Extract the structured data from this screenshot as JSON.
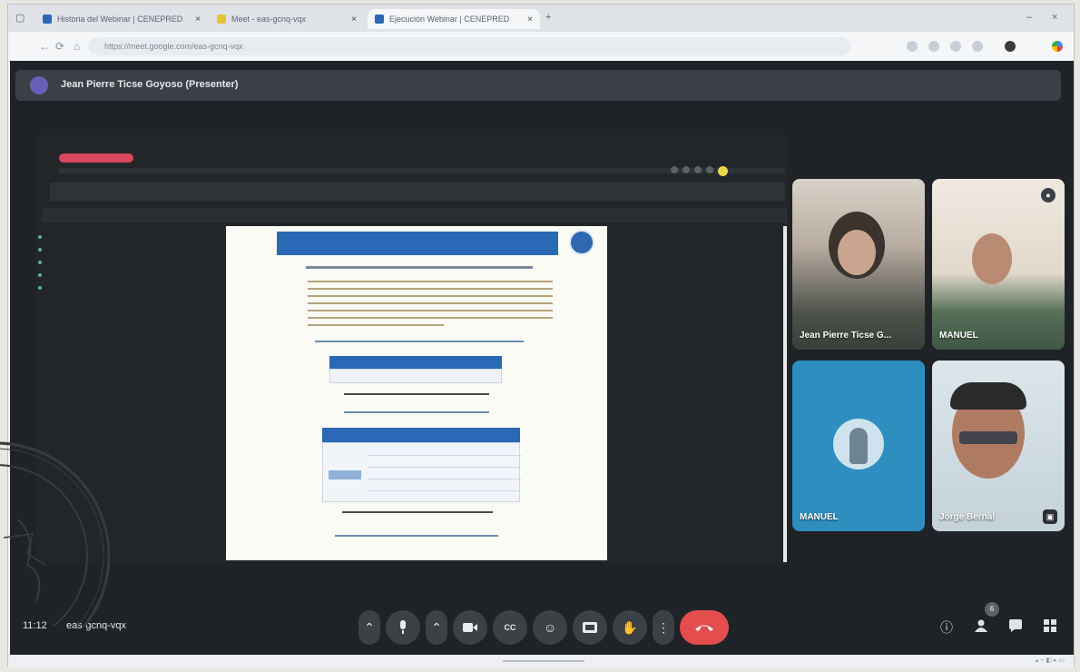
{
  "browser": {
    "tabs": [
      {
        "title": "Historia del Webinar | CENEPRED",
        "active": false,
        "favicon_color": "#2b68b5"
      },
      {
        "title": "Meet - eas-gcnq-vqx",
        "active": false,
        "favicon_color": "#e8c33a"
      },
      {
        "title": "Ejecución Webinar | CENEPRED",
        "active": true,
        "favicon_color": "#2b68b5"
      }
    ],
    "new_tab": "+",
    "url": "https://meet.google.com/eas-gcnq-vqx"
  },
  "meet": {
    "presenter_label": "Jean Pierre Ticse Goyoso (Presenter)",
    "participants": [
      {
        "name": "Jean Pierre Ticse G...",
        "camera": "on"
      },
      {
        "name": "MANUEL",
        "camera": "on"
      },
      {
        "name": "MANUEL",
        "camera": "off"
      },
      {
        "name": "Jorge Bernal",
        "camera": "on"
      }
    ],
    "meeting_code": "eas-gcnq-vqx",
    "time": "11:12",
    "participant_count": "6",
    "controls": {
      "more_audio": "⌃",
      "mic": "mic",
      "more_video": "⌃",
      "camera": "camera",
      "captions": "CC",
      "reactions": "☺",
      "present": "present",
      "raise_hand": "✋",
      "more": "⋮",
      "leave": "leave call"
    }
  },
  "colors": {
    "meet_bg": "#1f2327",
    "leave_red": "#e34d4d",
    "doc_header_blue": "#2b68b5"
  },
  "icons": {
    "info": "info-icon",
    "people": "people-icon",
    "chat": "chat-icon",
    "activities": "apps-grid-icon"
  }
}
